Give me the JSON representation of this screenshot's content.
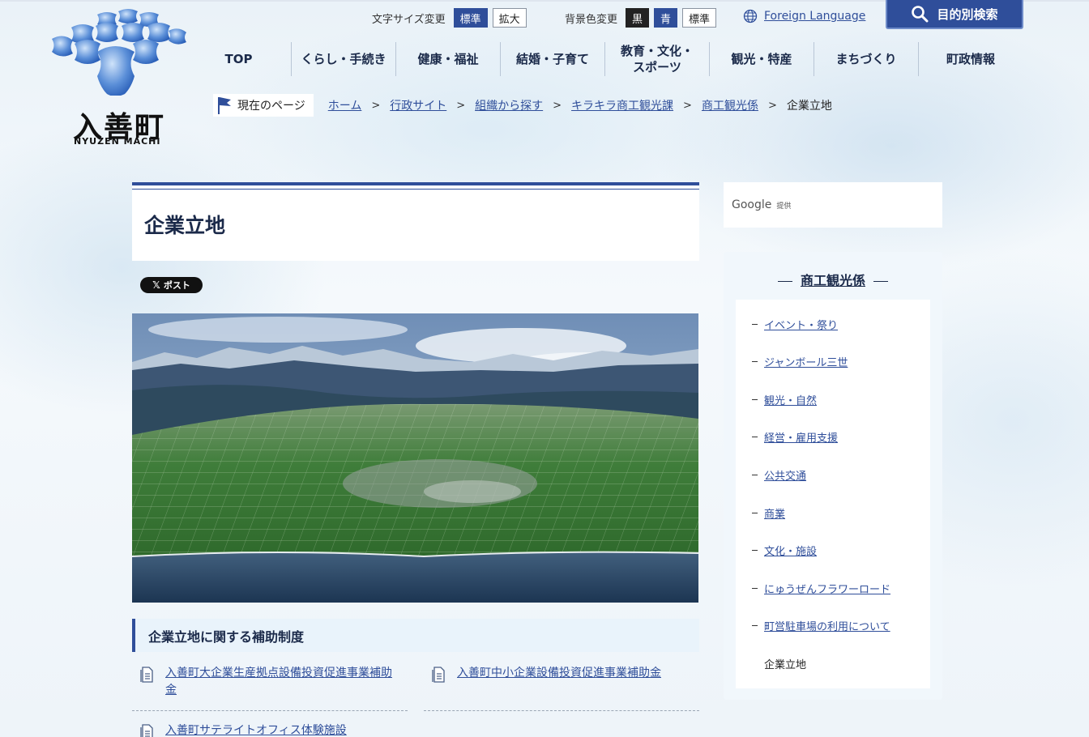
{
  "logo": {
    "name": "入善町",
    "sub": "NYUZEN MACHI"
  },
  "utility": {
    "font_size_label": "文字サイズ変更",
    "font_size_standard": "標準",
    "font_size_large": "拡大",
    "bg_label": "背景色変更",
    "bg_black": "黒",
    "bg_blue": "青",
    "bg_standard": "標準",
    "foreign_language": "Foreign Language",
    "search_button": "目的別検索"
  },
  "nav": {
    "items": [
      {
        "label": "TOP"
      },
      {
        "label": "くらし・手続き"
      },
      {
        "label": "健康・福祉"
      },
      {
        "label": "結婚・子育て"
      },
      {
        "label": "教育・文化・\nスポーツ"
      },
      {
        "label": "観光・特産"
      },
      {
        "label": "まちづくり"
      },
      {
        "label": "町政情報"
      }
    ]
  },
  "breadcrumb": {
    "here_label": "現在のページ",
    "items": [
      "ホーム",
      "行政サイト",
      "組織から探す",
      "キラキラ商工観光課",
      "商工観光係"
    ],
    "current": "企業立地"
  },
  "main": {
    "title": "企業立地",
    "x_post": "ポスト",
    "section_heading": "企業立地に関する補助制度",
    "links": [
      {
        "label": "入善町大企業生産拠点設備投資促進事業補助金"
      },
      {
        "label": "入善町中小企業設備投資促進事業補助金"
      },
      {
        "label": "入善町サテライトオフィス体験施設"
      }
    ]
  },
  "sidebar": {
    "search_brand": "Google",
    "search_provided": "提供",
    "title": "商工観光係",
    "items": [
      {
        "label": "イベント・祭り"
      },
      {
        "label": "ジャンボール三世"
      },
      {
        "label": "観光・自然"
      },
      {
        "label": "経営・雇用支援"
      },
      {
        "label": "公共交通"
      },
      {
        "label": "商業"
      },
      {
        "label": "文化・施設"
      },
      {
        "label": "にゅうぜんフラワーロード"
      },
      {
        "label": "町営駐車場の利用について"
      }
    ],
    "current": "企業立地"
  },
  "colors": {
    "brand": "#2f4e9a",
    "nav_text": "#1b2a4a",
    "heading_bg": "#e9f3fb"
  }
}
